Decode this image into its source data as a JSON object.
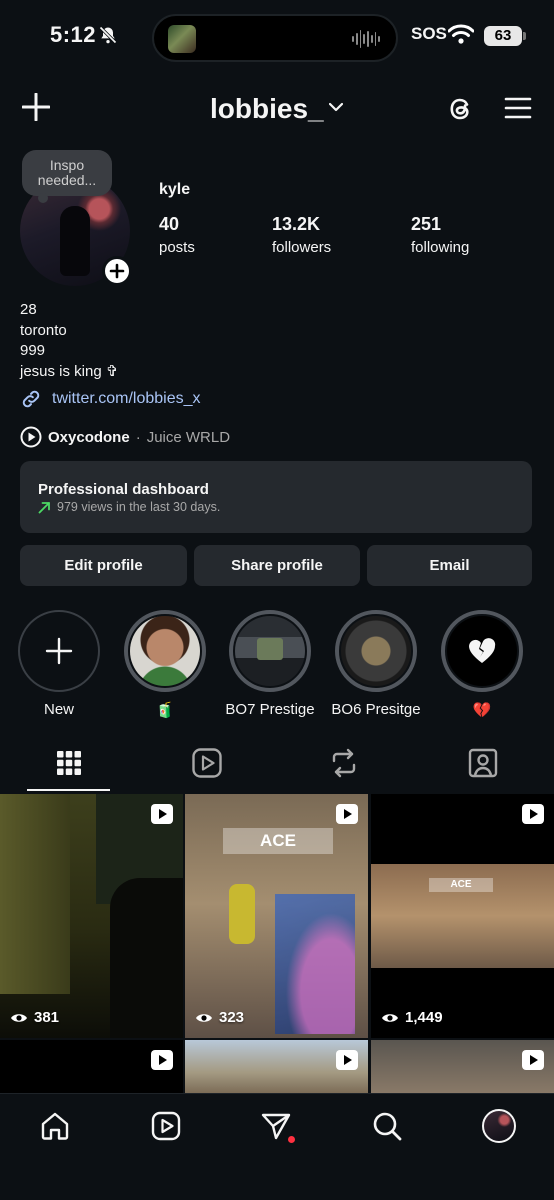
{
  "status_bar": {
    "time": "5:12",
    "sos": "SOS",
    "battery": "63"
  },
  "header": {
    "username": "lobbies_"
  },
  "profile": {
    "note": "Inspo needed...",
    "display_name": "kyle",
    "stats": [
      {
        "num": "40",
        "label": "posts"
      },
      {
        "num": "13.2K",
        "label": "followers"
      },
      {
        "num": "251",
        "label": "following"
      }
    ],
    "bio_lines": [
      "28",
      "toronto",
      "999",
      "jesus is king ✞"
    ],
    "link": "twitter.com/lobbies_x",
    "music": {
      "title": "Oxycodone",
      "separator": "·",
      "artist": "Juice WRLD"
    }
  },
  "dashboard": {
    "title": "Professional dashboard",
    "subtitle": "979 views in the last 30 days."
  },
  "buttons": {
    "edit": "Edit profile",
    "share": "Share profile",
    "email": "Email"
  },
  "highlights": [
    {
      "label": "New"
    },
    {
      "label": "🧃"
    },
    {
      "label": "BO7 Prestige"
    },
    {
      "label": "BO6 Presitge"
    },
    {
      "label": "💔"
    }
  ],
  "grid": {
    "posts": [
      {
        "views": "381"
      },
      {
        "views": "323"
      },
      {
        "views": "1,449"
      }
    ],
    "thumb_texts": [
      "ACE",
      "ACE"
    ]
  },
  "colors": {
    "background": "#0c1014",
    "surface": "#25292e",
    "link": "#a9c4f5",
    "notification": "#ff3040"
  },
  "icons": [
    "bell-off-icon",
    "wifi-icon",
    "plus-icon",
    "chevron-down-icon",
    "threads-icon",
    "menu-icon",
    "link-icon",
    "play-circle-icon",
    "trend-up-icon",
    "grid-icon",
    "reels-icon",
    "repost-icon",
    "tagged-icon",
    "reel-badge-icon",
    "eye-icon",
    "home-icon",
    "send-icon",
    "search-icon"
  ]
}
